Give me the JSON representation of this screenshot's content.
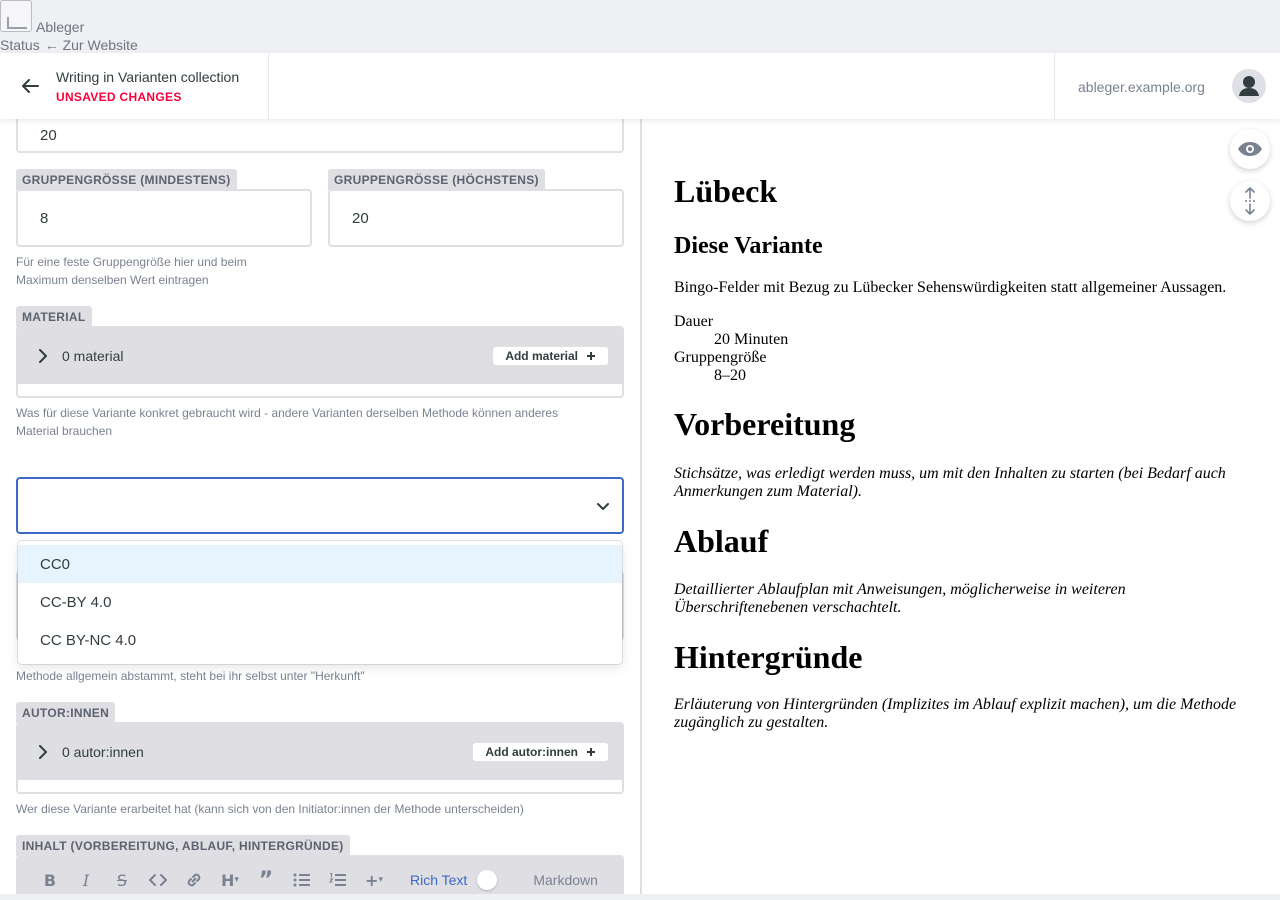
{
  "site": {
    "name": "Ableger",
    "links": [
      "Status",
      "← Zur Website"
    ]
  },
  "header": {
    "title": "Writing in Varianten collection",
    "status": "UNSAVED CHANGES",
    "site_url": "ableger.example.org"
  },
  "form": {
    "duration_value": "20",
    "group_min": {
      "label": "GRUPPENGRÖSSE (MINDESTENS)",
      "value": "8"
    },
    "group_max": {
      "label": "GRUPPENGRÖSSE (HÖCHSTENS)",
      "value": "20"
    },
    "group_hint_1": "Für eine feste Gruppengröße hier und beim",
    "group_hint_2": "Maximum denselben Wert eintragen",
    "material": {
      "label": "MATERIAL",
      "count": "0 material",
      "add_label": "Add material",
      "hint_1": "Was für diese Variante konkret gebraucht wird - andere Varianten derselben Methode können anderes",
      "hint_2": "Material brauchen"
    },
    "license": {
      "selected": "",
      "options": [
        "CC0",
        "CC-BY 4.0",
        "CC BY-NC 4.0"
      ],
      "hint_tail": "Methode allgemein abstammt, steht bei ihr selbst unter \"Herkunft\""
    },
    "authors": {
      "label": "AUTOR:INNEN",
      "count": "0 autor:innen",
      "add_label": "Add autor:innen",
      "hint": "Wer diese Variante erarbeitet hat (kann sich von den Initiator:innen der Methode unterscheiden)"
    },
    "content": {
      "label": "INHALT (VORBEREITUNG, ABLAUF, HINTERGRÜNDE)",
      "rich_text": "Rich Text",
      "markdown": "Markdown"
    }
  },
  "preview": {
    "title": "Lübeck",
    "variant_heading": "Diese Variante",
    "variant_text": "Bingo-Felder mit Bezug zu Lübecker Sehenswürdigkeiten statt allgemeiner Aussagen.",
    "duration_label": "Dauer",
    "duration_value": "20 Minuten",
    "group_label": "Gruppengröße",
    "group_value": "8–20",
    "prep_heading": "Vorbereitung",
    "prep_text": "Stichsätze, was erledigt werden muss, um mit den Inhalten zu starten (bei Bedarf auch Anmerkungen zum Material).",
    "flow_heading": "Ablauf",
    "flow_text": "Detaillierter Ablaufplan mit Anweisungen, möglicherweise in weiteren Überschriftenebenen verschachtelt.",
    "bg_heading": "Hintergründe",
    "bg_text": "Erläuterung von Hintergründen (Implizites im Ablauf explizit machen), um die Methode zugänglich zu gestalten."
  },
  "colors": {
    "accent": "#3a69c7",
    "unsaved": "#ff003b",
    "label_bg": "#dfdfe3",
    "option_focus": "#e8f4fd"
  },
  "icons": [
    "image-icon",
    "arrow-left-icon",
    "user-icon",
    "chevron-right-icon",
    "plus-icon",
    "chevron-down-icon",
    "eye-icon",
    "scroll-sync-icon",
    "bold-icon",
    "italic-icon",
    "strikethrough-icon",
    "code-icon",
    "link-icon",
    "heading-icon",
    "quote-icon",
    "bulleted-list-icon",
    "numbered-list-icon",
    "add-block-icon"
  ]
}
